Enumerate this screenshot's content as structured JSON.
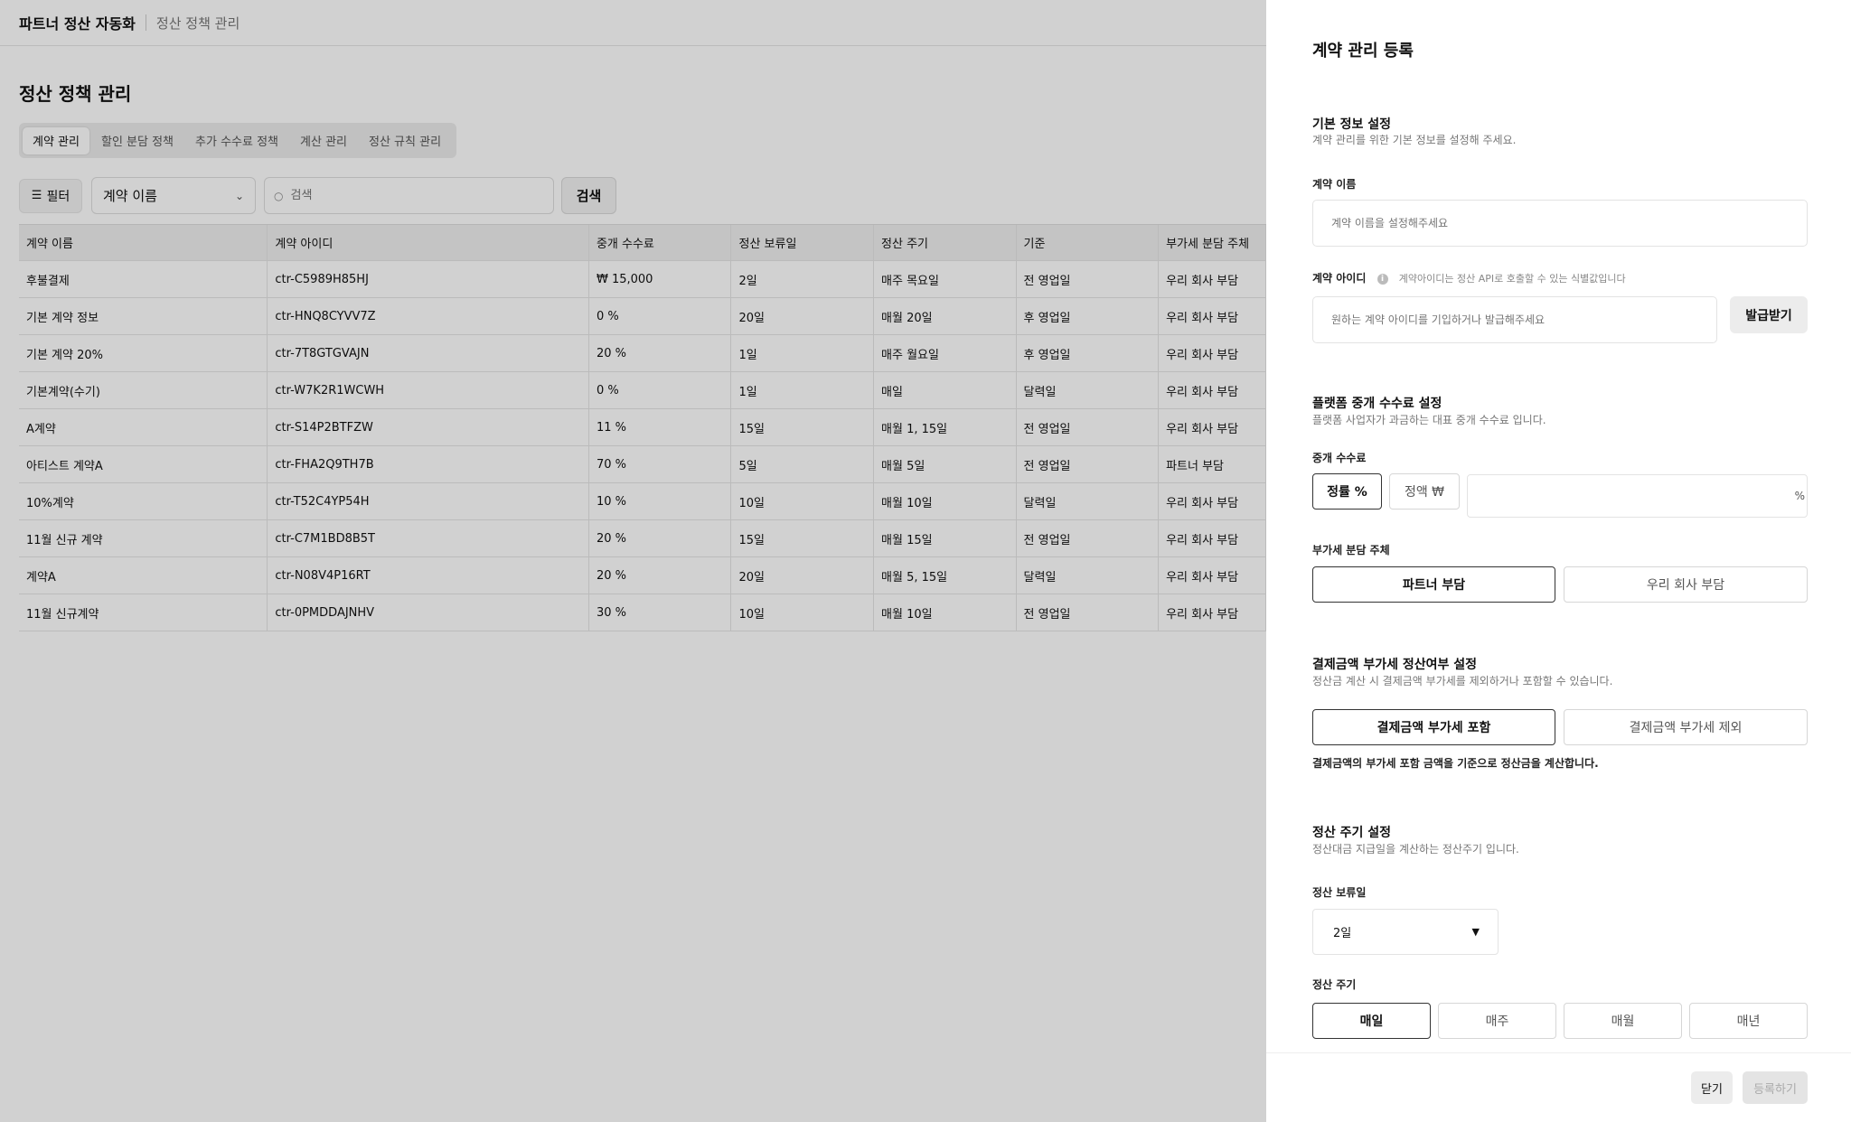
{
  "header": {
    "brand": "파트너 정산 자동화",
    "breadcrumb": "정산 정책 관리"
  },
  "page_title": "정산 정책 관리",
  "tabs": [
    {
      "label": "계약 관리",
      "active": true
    },
    {
      "label": "할인 분담 정책",
      "active": false
    },
    {
      "label": "추가 수수료 정책",
      "active": false
    },
    {
      "label": "계산 관리",
      "active": false
    },
    {
      "label": "정산 규칙 관리",
      "active": false
    }
  ],
  "toolbar": {
    "filter_label": "필터",
    "filter_icon": "filter-icon",
    "select_value": "계약 이름",
    "search_placeholder": "검색",
    "search_button": "검색"
  },
  "table": {
    "columns": [
      "계약 이름",
      "계약 아이디",
      "중개 수수료",
      "정산 보류일",
      "정산 주기",
      "기준",
      "부가세 분담 주체"
    ],
    "rows": [
      [
        "후불결제",
        "ctr-C5989H85HJ",
        "₩ 15,000",
        "2일",
        "매주 목요일",
        "전 영업일",
        "우리 회사 부담"
      ],
      [
        "기본 계약 정보",
        "ctr-HNQ8CYVV7Z",
        "0 %",
        "20일",
        "매월 20일",
        "후 영업일",
        "우리 회사 부담"
      ],
      [
        "기본 계약 20%",
        "ctr-7T8GTGVAJN",
        "20 %",
        "1일",
        "매주 월요일",
        "후 영업일",
        "우리 회사 부담"
      ],
      [
        "기본계약(수기)",
        "ctr-W7K2R1WCWH",
        "0 %",
        "1일",
        "매일",
        "달력일",
        "우리 회사 부담"
      ],
      [
        "A계약",
        "ctr-S14P2BTFZW",
        "11 %",
        "15일",
        "매월 1, 15일",
        "전 영업일",
        "우리 회사 부담"
      ],
      [
        "아티스트 계약A",
        "ctr-FHA2Q9TH7B",
        "70 %",
        "5일",
        "매월 5일",
        "전 영업일",
        "파트너 부담"
      ],
      [
        "10%계약",
        "ctr-T52C4YP54H",
        "10 %",
        "10일",
        "매월 10일",
        "달력일",
        "우리 회사 부담"
      ],
      [
        "11월 신규 계약",
        "ctr-C7M1BD8B5T",
        "20 %",
        "15일",
        "매월 15일",
        "전 영업일",
        "우리 회사 부담"
      ],
      [
        "계약A",
        "ctr-N08V4P16RT",
        "20 %",
        "20일",
        "매월 5, 15일",
        "달력일",
        "우리 회사 부담"
      ],
      [
        "11월 신규계약",
        "ctr-0PMDDAJNHV",
        "30 %",
        "10일",
        "매월 10일",
        "전 영업일",
        "우리 회사 부담"
      ]
    ]
  },
  "panel": {
    "title": "계약 관리 등록",
    "basic": {
      "title": "기본 정보 설정",
      "desc": "계약 관리를 위한 기본 정보를 설정해 주세요.",
      "name_label": "계약 이름",
      "name_placeholder": "계약 이름을 설정해주세요",
      "id_label": "계약 아이디",
      "id_hint": "계약아이디는 정산 API로 호출할 수 있는 식별값입니다",
      "id_placeholder": "원하는 계약 아이디를 기입하거나 발급해주세요",
      "issue_button": "발급받기"
    },
    "fee": {
      "title": "플랫폼 중개 수수료 설정",
      "desc": "플랫폼 사업자가 과금하는 대표 중개 수수료 입니다.",
      "label": "중개 수수료",
      "rate_button": "정률 %",
      "fixed_button": "정액 ₩",
      "unit": "%",
      "vat_label": "부가세 분담 주체",
      "vat_partner": "파트너 부담",
      "vat_company": "우리 회사 부담"
    },
    "payment_vat": {
      "title": "결제금액 부가세 정산여부 설정",
      "desc": "정산금 계산 시 결제금액 부가세를 제외하거나 포함할 수 있습니다.",
      "include": "결제금액 부가세 포함",
      "exclude": "결제금액 부가세 제외",
      "note": "결제금액의 부가세 포함 금액을 기준으로 정산금을 계산합니다."
    },
    "cycle": {
      "title": "정산 주기 설정",
      "desc": "정산대금 지급일을 계산하는 정산주기 입니다.",
      "hold_label": "정산 보류일",
      "hold_value": "2일",
      "cycle_label": "정산 주기",
      "options": [
        "매일",
        "매주",
        "매월",
        "매년"
      ]
    },
    "footer": {
      "close": "닫기",
      "submit": "등록하기"
    }
  }
}
